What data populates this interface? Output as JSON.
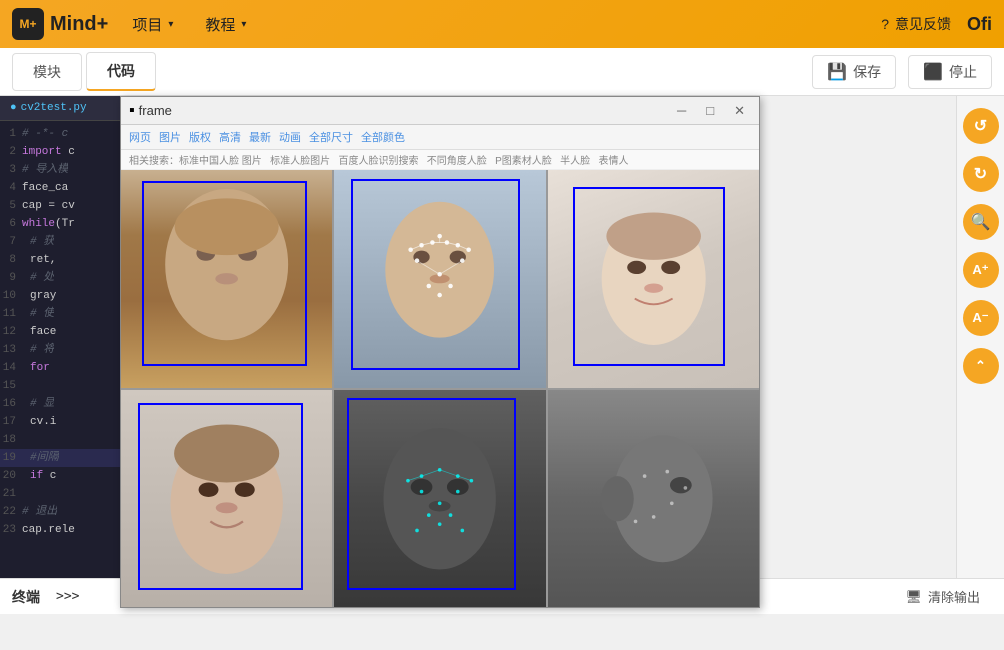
{
  "topbar": {
    "logo_text": "Mind+",
    "menu_items": [
      {
        "label": "项目",
        "id": "menu-project"
      },
      {
        "label": "教程",
        "id": "menu-tutorial"
      }
    ],
    "feedback_label": "意见反馈",
    "ofi_label": "Ofi"
  },
  "toolbar": {
    "tabs": [
      {
        "label": "模块",
        "active": false
      },
      {
        "label": "代码",
        "active": true
      }
    ],
    "save_label": "保存",
    "stop_label": "停止"
  },
  "file_tab": {
    "filename": "cv2test.py"
  },
  "code_lines": [
    {
      "num": "1",
      "content": "# -*- c",
      "class": "cm"
    },
    {
      "num": "2",
      "content": "import c",
      "class": ""
    },
    {
      "num": "3",
      "content": "# 导入模",
      "class": "cm"
    },
    {
      "num": "4",
      "content": "face_ca",
      "class": ""
    },
    {
      "num": "5",
      "content": "cap = cv",
      "class": ""
    },
    {
      "num": "6",
      "content": "while(Tr",
      "class": "kw"
    },
    {
      "num": "7",
      "content": "    # 获",
      "class": "cm indent1"
    },
    {
      "num": "8",
      "content": "    ret,",
      "class": "indent1"
    },
    {
      "num": "9",
      "content": "    # 处",
      "class": "cm indent1"
    },
    {
      "num": "10",
      "content": "    gray",
      "class": "indent1"
    },
    {
      "num": "11",
      "content": "    # 使",
      "class": "cm indent1"
    },
    {
      "num": "12",
      "content": "    face",
      "class": "indent1"
    },
    {
      "num": "13",
      "content": "    # 将",
      "class": "cm indent1"
    },
    {
      "num": "14",
      "content": "    for ",
      "class": "kw indent1"
    },
    {
      "num": "15",
      "content": "",
      "class": ""
    },
    {
      "num": "16",
      "content": "    # 显",
      "class": "cm indent1"
    },
    {
      "num": "17",
      "content": "    cv.i",
      "class": "indent1"
    },
    {
      "num": "18",
      "content": "",
      "class": ""
    },
    {
      "num": "19",
      "content": "    #间隔",
      "class": "cm indent1 hl"
    },
    {
      "num": "20",
      "content": "    if c",
      "class": "kw indent1"
    },
    {
      "num": "21",
      "content": "",
      "class": ""
    },
    {
      "num": "22",
      "content": "# 退出",
      "class": "cm"
    },
    {
      "num": "23",
      "content": "cap.rele",
      "class": ""
    }
  ],
  "frame_window": {
    "title": "frame",
    "baidu_links": [
      "网页",
      "图片",
      "版权",
      "高清",
      "最新",
      "动画",
      "全部尺寸",
      "全部颜色"
    ],
    "search_tags": [
      "相关搜索：标准中国人脸 图片",
      "标准人脸图片",
      "百度人脸识别搜索",
      "不同角度人脸",
      "P图素材人脸",
      "半人脸",
      "表情人"
    ]
  },
  "right_sidebar": {
    "buttons": [
      {
        "icon": "↺",
        "label": "undo-btn"
      },
      {
        "icon": "↻",
        "label": "redo-btn"
      },
      {
        "icon": "🔍",
        "label": "zoom-btn"
      },
      {
        "icon": "A⁺",
        "label": "font-increase-btn"
      },
      {
        "icon": "A⁻",
        "label": "font-decrease-btn"
      },
      {
        "icon": "⌃",
        "label": "top-btn"
      }
    ]
  },
  "terminal": {
    "label": "终端",
    "prompt": ">>>",
    "clear_label": "清除输出"
  }
}
